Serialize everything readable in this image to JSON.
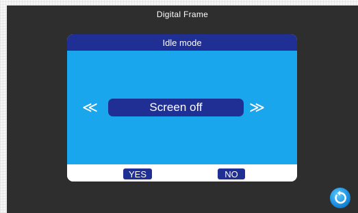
{
  "window": {
    "title": "Digital Frame"
  },
  "dialog": {
    "title": "Idle mode",
    "value": "Screen off",
    "prev_icon": "≪",
    "next_icon": "≫",
    "yes_label": "YES",
    "no_label": "NO"
  },
  "icons": {
    "back": "back-arrow-icon",
    "prev": "double-chevron-left-icon",
    "next": "double-chevron-right-icon"
  },
  "colors": {
    "screen_bg": "#2e2e2e",
    "accent_dark_blue": "#1f2f93",
    "panel_light_blue": "#1aa6ec"
  }
}
